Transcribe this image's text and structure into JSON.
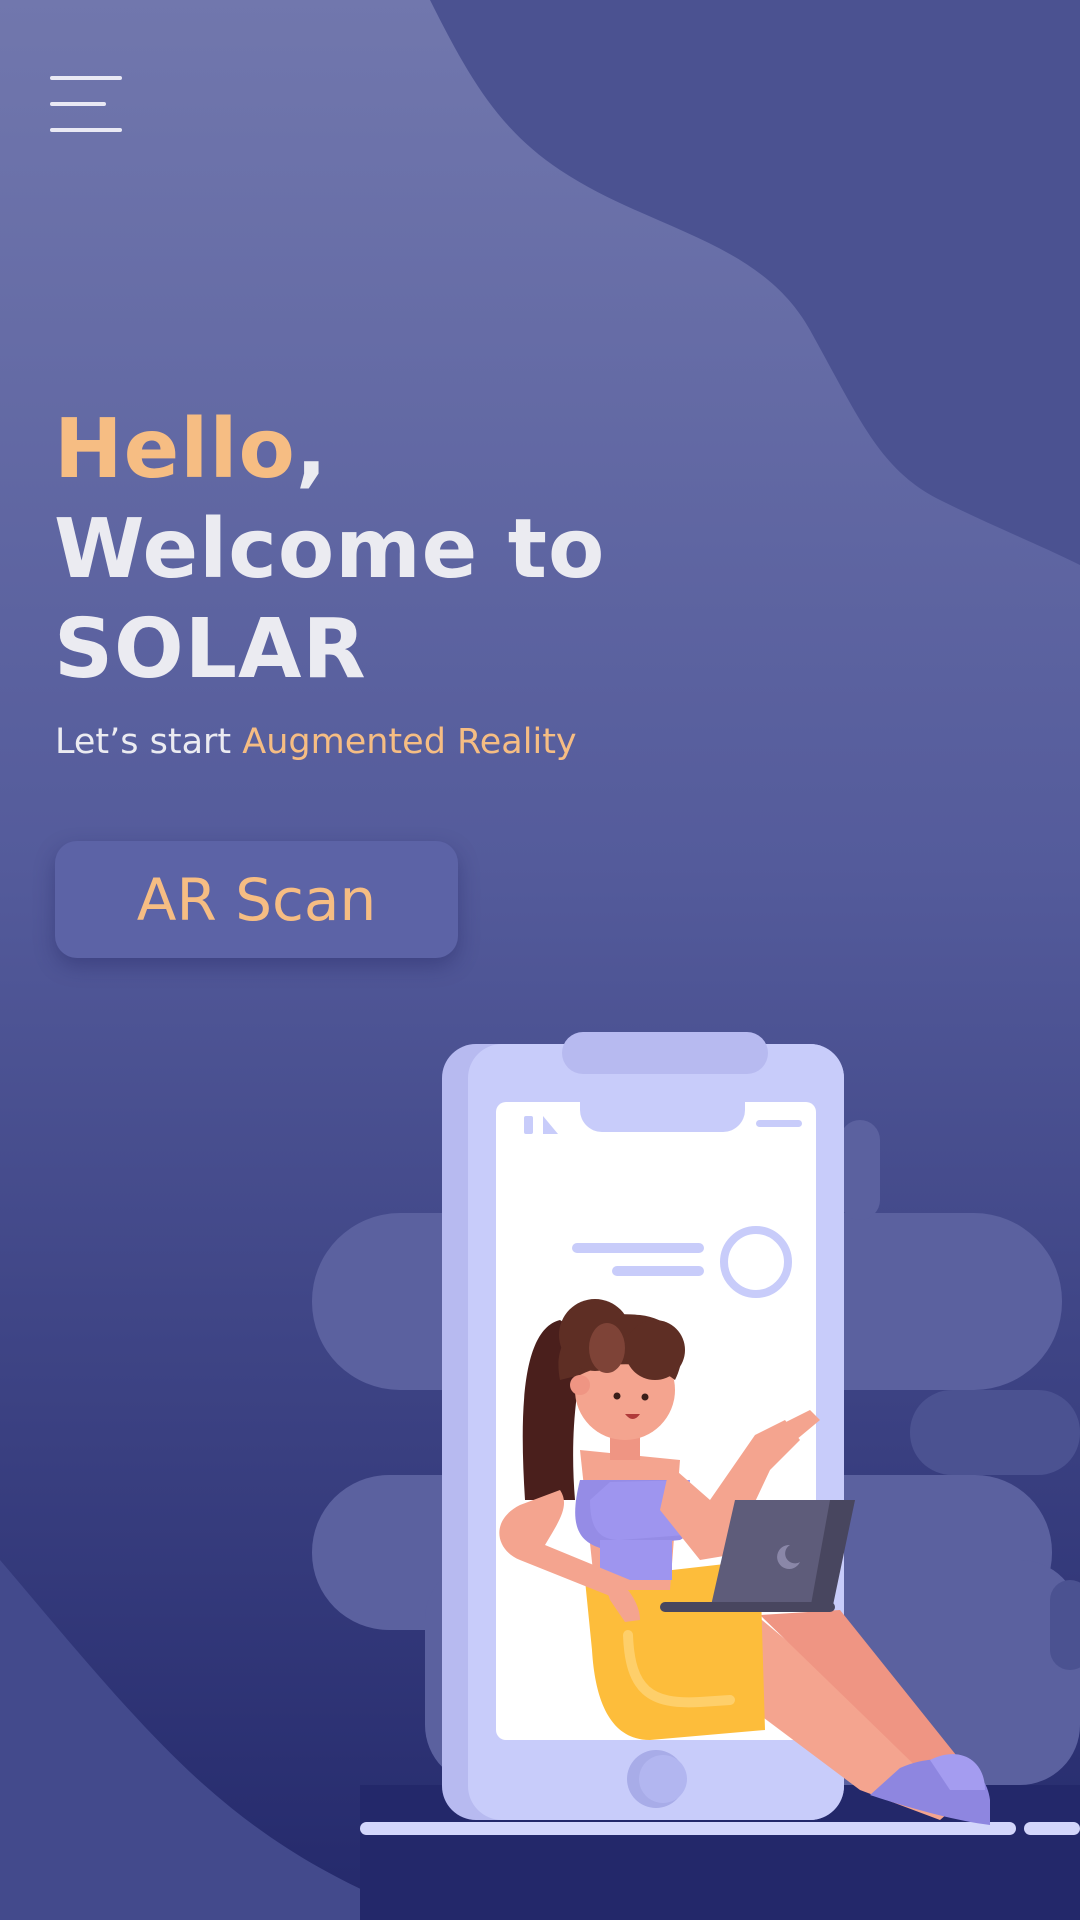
{
  "header": {
    "menu_icon": "hamburger-menu-icon"
  },
  "hero": {
    "greeting": "Hello",
    "greeting_punct": ",",
    "line2": "Welcome to",
    "line3": "SOLAR",
    "subtitle_prefix": "Let’s start ",
    "subtitle_highlight": "Augmented Reality"
  },
  "cta": {
    "label": "AR Scan"
  },
  "colors": {
    "background_top": "#6f75ad",
    "background_bottom": "#23286a",
    "accent": "#f6bd83",
    "text": "#ebebf1",
    "button": "#5c63a6"
  },
  "illustration": {
    "icon": "girl-with-laptop-in-phone-illustration"
  }
}
